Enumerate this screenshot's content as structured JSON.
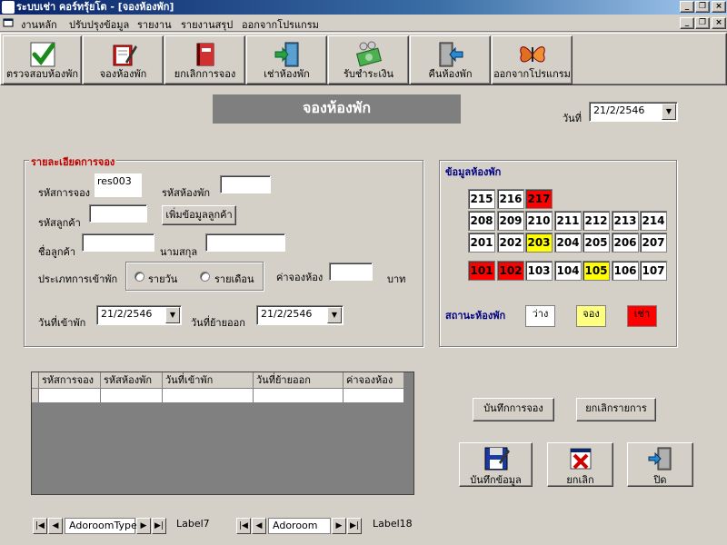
{
  "window": {
    "title": "ระบบเช่า คอร์ทรุ้ยโต - [จองห้องพัก]",
    "min_glyph": "_",
    "restore_glyph": "❐",
    "close_glyph": "×"
  },
  "menu": {
    "items": [
      "งานหลัก",
      "ปรับปรุงข้อมูล",
      "รายงาน",
      "รายงานสรุป",
      "ออกจากโปรแกรม"
    ]
  },
  "toolbar": {
    "buttons": [
      {
        "label": "ตรวจสอบห้องพัก",
        "icon": "checkmark-icon"
      },
      {
        "label": "จองห้องพัก",
        "icon": "notebook-pen-icon"
      },
      {
        "label": "ยกเลิกการจอง",
        "icon": "book-icon"
      },
      {
        "label": "เช่าห้องพัก",
        "icon": "enter-door-icon"
      },
      {
        "label": "รับชำระเงิน",
        "icon": "money-icon"
      },
      {
        "label": "คืนห้องพัก",
        "icon": "exit-door-icon"
      },
      {
        "label": "ออกจากโปรแกรม",
        "icon": "butterfly-icon"
      }
    ]
  },
  "form": {
    "title": "จองห้องพัก",
    "date_label": "วันที่",
    "date_value": "21/2/2546"
  },
  "details": {
    "title": "รายละเอียดการจอง",
    "reservation_id_label": "รหัสการจอง",
    "reservation_id_value": "res003",
    "room_id_label": "รหัสห้องพัก",
    "room_id_value": "",
    "customer_id_label": "รหัสลูกค้า",
    "customer_id_value": "",
    "add_customer_button": "เพิ่มข้อมูลลูกค้า",
    "first_name_label": "ชื่อลูกค้า",
    "first_name_value": "",
    "last_name_label": "นามสกุล",
    "last_name_value": "",
    "stay_type_label": "ประเภทการเข้าพัก",
    "daily_label": "รายวัน",
    "monthly_label": "รายเดือน",
    "price_label": "ค่าจองห้อง",
    "price_value": "",
    "currency_label": "บาท",
    "checkin_label": "วันที่เข้าพัก",
    "checkin_value": "21/2/2546",
    "checkout_label": "วันที่ย้ายออก",
    "checkout_value": "21/2/2546"
  },
  "rooms": {
    "title": "ข้อมูลห้องพัก",
    "rows": [
      [
        {
          "no": "215",
          "status": "vacant"
        },
        {
          "no": "216",
          "status": "vacant"
        },
        {
          "no": "217",
          "status": "rented"
        }
      ],
      [
        {
          "no": "208",
          "status": "vacant"
        },
        {
          "no": "209",
          "status": "vacant"
        },
        {
          "no": "210",
          "status": "vacant"
        },
        {
          "no": "211",
          "status": "vacant"
        },
        {
          "no": "212",
          "status": "vacant"
        },
        {
          "no": "213",
          "status": "vacant"
        },
        {
          "no": "214",
          "status": "vacant"
        }
      ],
      [
        {
          "no": "201",
          "status": "vacant"
        },
        {
          "no": "202",
          "status": "vacant"
        },
        {
          "no": "203",
          "status": "reserved"
        },
        {
          "no": "204",
          "status": "vacant"
        },
        {
          "no": "205",
          "status": "vacant"
        },
        {
          "no": "206",
          "status": "vacant"
        },
        {
          "no": "207",
          "status": "vacant"
        }
      ],
      [
        {
          "no": "101",
          "status": "rented"
        },
        {
          "no": "102",
          "status": "rented"
        },
        {
          "no": "103",
          "status": "vacant"
        },
        {
          "no": "104",
          "status": "vacant"
        },
        {
          "no": "105",
          "status": "reserved"
        },
        {
          "no": "106",
          "status": "vacant"
        },
        {
          "no": "107",
          "status": "vacant"
        }
      ]
    ],
    "legend_title": "สถานะห้องพัก",
    "legend": [
      {
        "label": "ว่าง",
        "color": "#ffffff"
      },
      {
        "label": "จอง",
        "color": "#ffff80"
      },
      {
        "label": "เช่า",
        "color": "#ff0000"
      }
    ],
    "colors": {
      "vacant": "#ffffff",
      "reserved": "#ffff00",
      "rented": "#ff0000"
    }
  },
  "grid": {
    "columns": [
      "รหัสการจอง",
      "รหัสห้องพัก",
      "วันที่เข้าพัก",
      "วันที่ย้ายออก",
      "ค่าจองห้อง"
    ]
  },
  "actions": {
    "save_reservation": "บันทึกการจอง",
    "cancel_item": "ยกเลิกรายการ",
    "save_data": "บันทึกข้อมูล",
    "cancel": "ยกเลิก",
    "close": "ปิด"
  },
  "navigators": [
    {
      "caption": "AdoroomType",
      "label": "Label7"
    },
    {
      "caption": "Adoroom",
      "label": "Label18"
    }
  ],
  "nav_glyphs": {
    "first": "|◀",
    "prev": "◀",
    "next": "▶",
    "last": "▶|",
    "dropdown": "▼"
  }
}
